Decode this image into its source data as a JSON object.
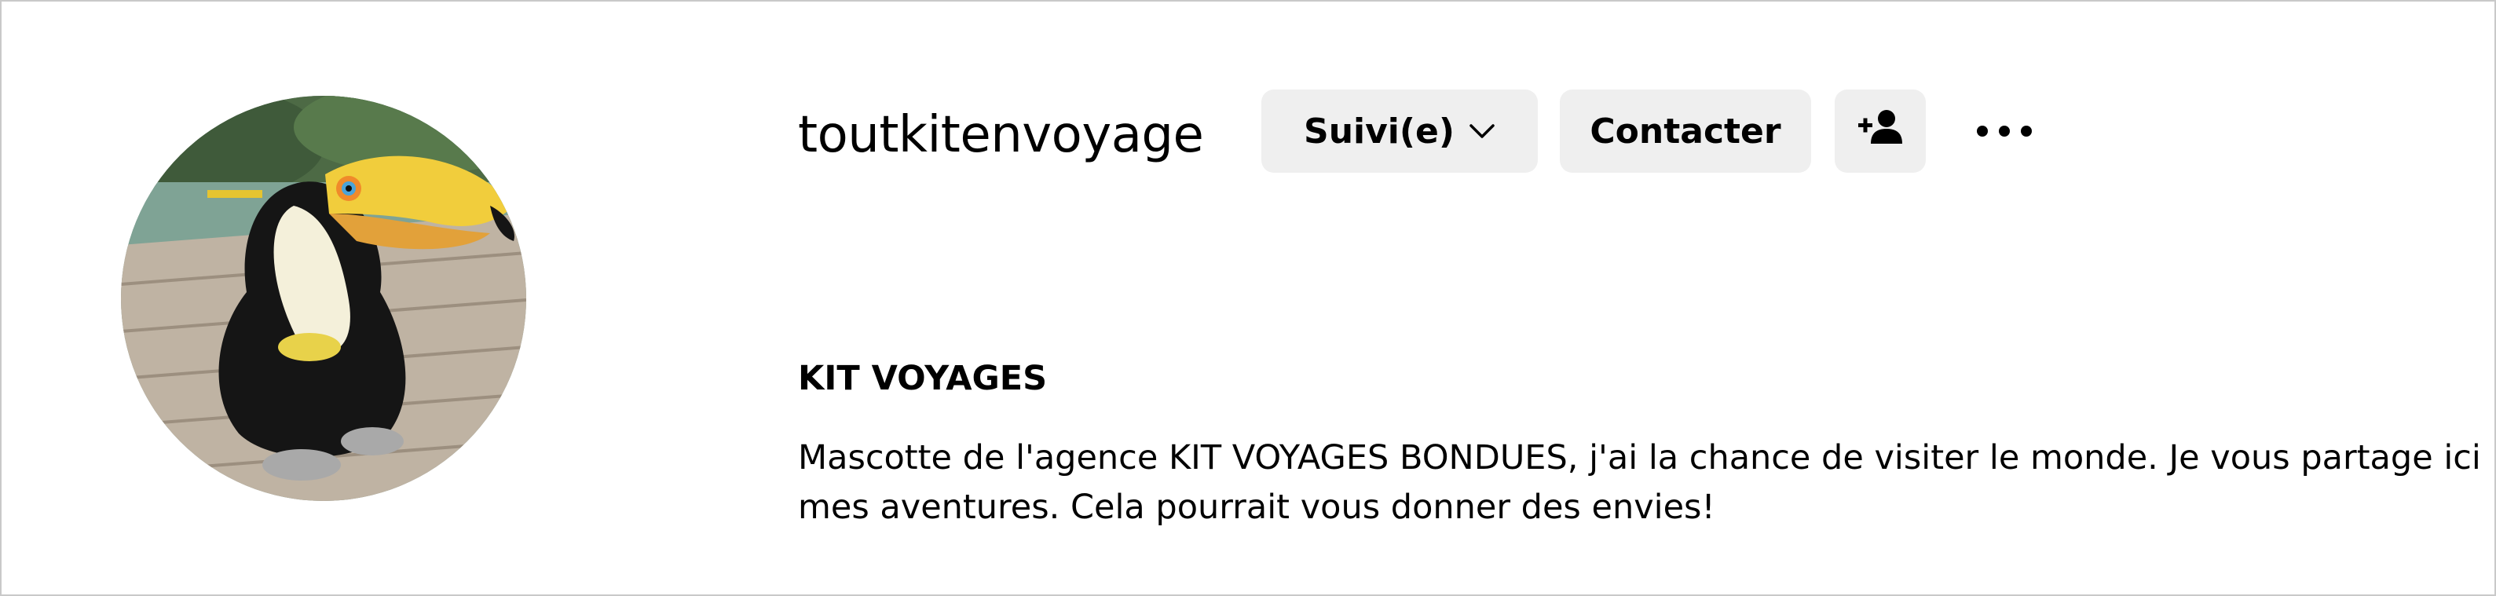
{
  "profile": {
    "username": "toutkitenvoyage",
    "full_name": "KIT VOYAGES",
    "bio": "Mascotte de l'agence KIT VOYAGES BONDUES, j'ai la chance de visiter le monde. Je vous partage ici mes aventures. Cela pourrait vous donner des envies!",
    "avatar": "toucan-plush-photo"
  },
  "actions": {
    "follow_label": "Suivi(e)",
    "contact_label": "Contacter",
    "add_user_icon": "add-person-icon",
    "more_icon": "more-options-icon",
    "chevron_icon": "chevron-down-icon"
  },
  "colors": {
    "button_bg": "#efefef",
    "text": "#000000",
    "border": "#c9c9c9"
  }
}
